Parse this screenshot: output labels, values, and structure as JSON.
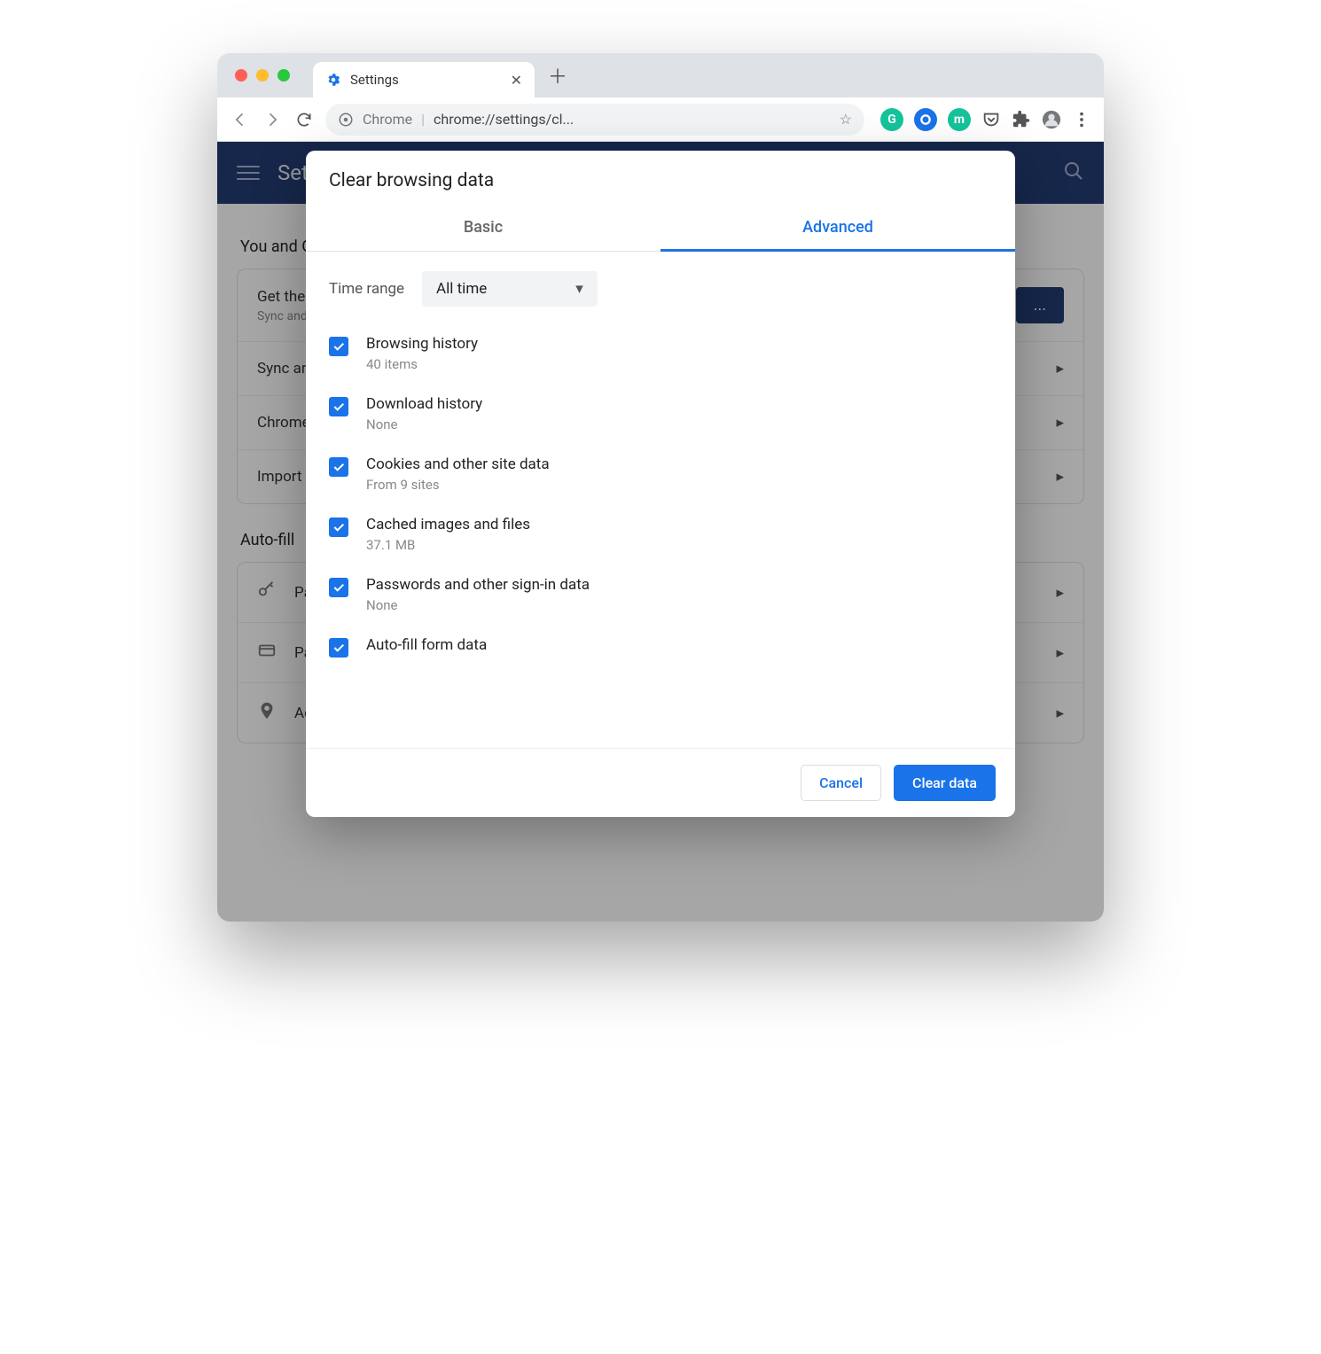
{
  "tab": {
    "title": "Settings"
  },
  "omnibox": {
    "scheme_label": "Chrome",
    "url": "chrome://settings/cl..."
  },
  "header": {
    "title": "Settings"
  },
  "sections": {
    "you": {
      "title": "You and Google",
      "rows": [
        {
          "title": "Get the most out of Chrome",
          "sub": "Sync and personalise Chrome across your devices",
          "button": "..."
        },
        {
          "title": "Sync and Google services"
        },
        {
          "title": "Chrome name and picture"
        },
        {
          "title": "Import bookmarks and settings"
        }
      ]
    },
    "autofill": {
      "title": "Auto-fill",
      "rows": [
        {
          "title": "Passwords"
        },
        {
          "title": "Payment methods"
        },
        {
          "title": "Addresses and more"
        }
      ]
    }
  },
  "dialog": {
    "title": "Clear browsing data",
    "tabs": {
      "basic": "Basic",
      "advanced": "Advanced"
    },
    "time_label": "Time range",
    "time_value": "All time",
    "items": [
      {
        "title": "Browsing history",
        "sub": "40 items"
      },
      {
        "title": "Download history",
        "sub": "None"
      },
      {
        "title": "Cookies and other site data",
        "sub": "From 9 sites"
      },
      {
        "title": "Cached images and files",
        "sub": "37.1 MB"
      },
      {
        "title": "Passwords and other sign-in data",
        "sub": "None"
      },
      {
        "title": "Auto-fill form data",
        "sub": ""
      }
    ],
    "actions": {
      "cancel": "Cancel",
      "clear": "Clear data"
    }
  }
}
